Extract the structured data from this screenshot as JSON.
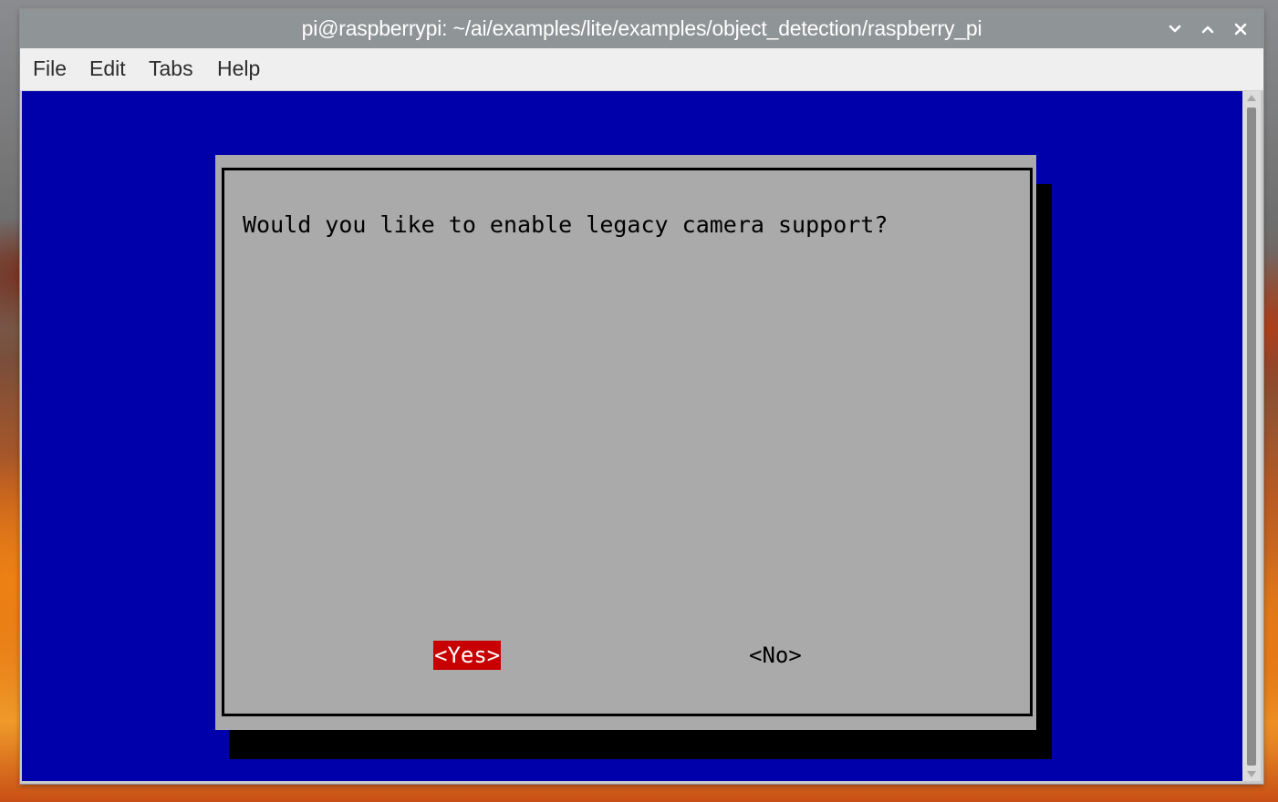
{
  "window": {
    "title": "pi@raspberrypi: ~/ai/examples/lite/examples/object_detection/raspberry_pi",
    "controls": [
      {
        "name": "minimize",
        "icon": "chevron-down-icon"
      },
      {
        "name": "maximize",
        "icon": "chevron-up-icon"
      },
      {
        "name": "close",
        "icon": "close-icon"
      }
    ]
  },
  "menu": {
    "items": [
      {
        "label": "File"
      },
      {
        "label": "Edit"
      },
      {
        "label": "Tabs"
      },
      {
        "label": "Help"
      }
    ]
  },
  "dialog": {
    "prompt": "Would you like to enable legacy camera support?",
    "yes_label": "<Yes>",
    "no_label": "<No>",
    "selected": "yes"
  },
  "colors": {
    "terminal_background": "#0000aa",
    "dialog_background": "#aaaaaa",
    "selected_button": "#c80000",
    "titlebar": "#8f9496"
  }
}
